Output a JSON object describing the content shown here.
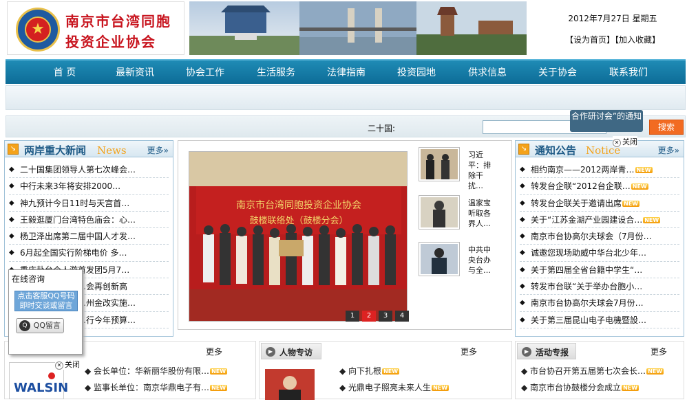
{
  "header": {
    "org_name_line1": "南京市台湾同胞",
    "org_name_line2": "投资企业协会",
    "emblem_glyph": "★",
    "date": "2012年7月27日 星期五",
    "set_home": "【设为首页】",
    "add_fav": "【加入收藏】"
  },
  "nav": [
    "首 页",
    "最新资讯",
    "协会工作",
    "生活服务",
    "法律指南",
    "投资园地",
    "供求信息",
    "关于协会",
    "联系我们"
  ],
  "search": {
    "label": "二十国:",
    "placeholder": "",
    "button": "搜索"
  },
  "news_panel": {
    "title": "两岸重大新闻",
    "title_en": "News",
    "more": "更多",
    "items": [
      "二十国集团领导人第七次峰会…",
      "中行未来3年将安排2000…",
      "神九预计今日11时与天宫首…",
      "王毅逛厦门台湾特色庙会：心…",
      "杨卫泽出席第二届中国人才发…",
      "6月起全国实行阶梯电价 多…",
      "重庆赴台个人游首发团5月7…",
      "…会再创新高",
      "…州金改实施…",
      "…行今年预算…"
    ]
  },
  "featured": {
    "pages": [
      "1",
      "2",
      "3",
      "4"
    ],
    "active_page": "2",
    "thumbs": [
      {
        "caption": "习近平：排除干扰…"
      },
      {
        "caption": "温家宝听取各界人…"
      },
      {
        "caption": "中共中央台办与全…"
      }
    ],
    "photo_banner_line1": "南京市台湾同胞投资企业协会",
    "photo_banner_line2": "鼓楼联络处（鼓楼分会）"
  },
  "notice_panel": {
    "title": "通知公告",
    "title_en": "Notice",
    "more": "更多",
    "new_badge": "NEW",
    "items": [
      {
        "text": "相约南京——2012两岸青…",
        "new": true
      },
      {
        "text": "转发台企联“2012台企联…",
        "new": true
      },
      {
        "text": "转发台企联关于邀请出席",
        "new": true
      },
      {
        "text": "关于“江苏金湖产业园建设合…",
        "new": true
      },
      {
        "text": "南京市台协高尔夫球会（7月份…",
        "new": false
      },
      {
        "text": "诚邀您现场助威中华台北少年…",
        "new": false
      },
      {
        "text": "关于第四届全省台籍中学生“…",
        "new": false
      },
      {
        "text": "转发市台联“关于举办台胞小…",
        "new": false
      },
      {
        "text": "南京市台协高尔夫球会7月份…",
        "new": false
      },
      {
        "text": "关于第三届昆山电子电機暨設…",
        "new": false
      }
    ]
  },
  "float_left": {
    "title": "在线咨询",
    "button": "点击客服QQ号码即时交谈或留言",
    "qq": "QQ留言"
  },
  "float_right": {
    "text": "合作研讨会”的通知",
    "close": "关闭"
  },
  "bottom": {
    "col1": {
      "more": "更多",
      "close": "关闭",
      "logo_text": "WALSIN",
      "items": [
        {
          "text": "会长单位：华新丽华股份有限…",
          "new": true
        },
        {
          "text": "监事长单位：南京华鼎电子有…",
          "new": true
        }
      ]
    },
    "col2": {
      "title": "人物专访",
      "more": "更多",
      "items": [
        {
          "text": "向下扎根",
          "new": true
        },
        {
          "text": "光鼎电子照亮未来人生",
          "new": true
        }
      ]
    },
    "col3": {
      "title": "活动专报",
      "more": "更多",
      "items": [
        {
          "text": "市台协召开第五届第七次会长…",
          "new": true
        },
        {
          "text": "南京市台协鼓楼分会成立",
          "new": true
        }
      ]
    }
  },
  "colors": {
    "nav": "#0d6c97",
    "brand_red": "#c8141e",
    "search_button": "#f26b22",
    "panel_border": "#9ec1d8"
  }
}
